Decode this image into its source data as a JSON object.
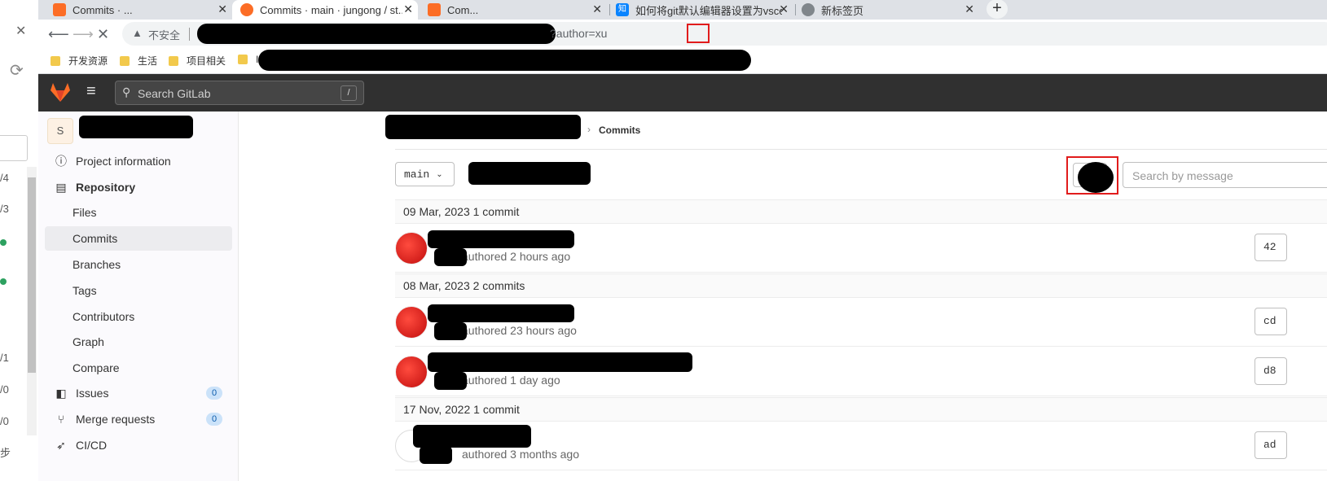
{
  "browser": {
    "tabs": [
      {
        "title": "Commits · ...",
        "icon": "gitlab-icon",
        "active": false
      },
      {
        "title": "Commits · main · jungong / st...",
        "icon": "gitlab-icon",
        "active": true
      },
      {
        "title": "Com...",
        "icon": "gitlab-icon",
        "active": false
      },
      {
        "title": "如何将git默认编辑器设置为vsco...",
        "icon": "zhihu-icon",
        "active": false
      },
      {
        "title": "新标签页",
        "icon": "globe-icon",
        "active": false
      }
    ],
    "close_glyph": "✕",
    "new_tab_glyph": "+",
    "security_label": "不安全",
    "url_tail": "?author=xu",
    "bookmarks": [
      "开发资源",
      "生活",
      "项目相关",
      "In"
    ]
  },
  "left_window": {
    "fragments": [
      "/4",
      "/3",
      "/1",
      "/0",
      "/0",
      "步"
    ]
  },
  "gitlab": {
    "search_placeholder": "Search GitLab",
    "search_shortcut": "/",
    "menu_glyph": "≡",
    "project_initial": "S",
    "sidebar": {
      "items": [
        {
          "label": "Project information",
          "icon": "info-icon",
          "glyph": "ⓘ"
        },
        {
          "label": "Repository",
          "icon": "repository-icon",
          "glyph": "▤"
        },
        {
          "label": "Files"
        },
        {
          "label": "Commits"
        },
        {
          "label": "Branches"
        },
        {
          "label": "Tags"
        },
        {
          "label": "Contributors"
        },
        {
          "label": "Graph"
        },
        {
          "label": "Compare"
        },
        {
          "label": "Issues",
          "icon": "issues-icon",
          "glyph": "◧",
          "badge": "0"
        },
        {
          "label": "Merge requests",
          "icon": "merge-request-icon",
          "glyph": "⑂",
          "badge": "0"
        },
        {
          "label": "CI/CD",
          "icon": "rocket-icon",
          "glyph": "➶"
        }
      ]
    },
    "breadcrumb_current": "Commits",
    "branch": "main",
    "message_search_placeholder": "Search by message",
    "days": [
      {
        "date": "09 Mar, 2023",
        "count": "1 commit",
        "commits": [
          {
            "meta": "authored 2 hours ago",
            "sha": "42"
          }
        ]
      },
      {
        "date": "08 Mar, 2023",
        "count": "2 commits",
        "commits": [
          {
            "meta": "authored 23 hours ago",
            "sha": "cd"
          },
          {
            "meta": "authored 1 day ago",
            "sha": "d8"
          }
        ]
      },
      {
        "date": "17 Nov, 2022",
        "count": "1 commit",
        "commits": [
          {
            "meta": "authored 3 months ago",
            "sha": "ad"
          }
        ]
      }
    ]
  },
  "colors": {
    "gitlab_header": "#303030",
    "highlight_red": "#e11c1c",
    "badge_bg": "#cbe2f9"
  }
}
